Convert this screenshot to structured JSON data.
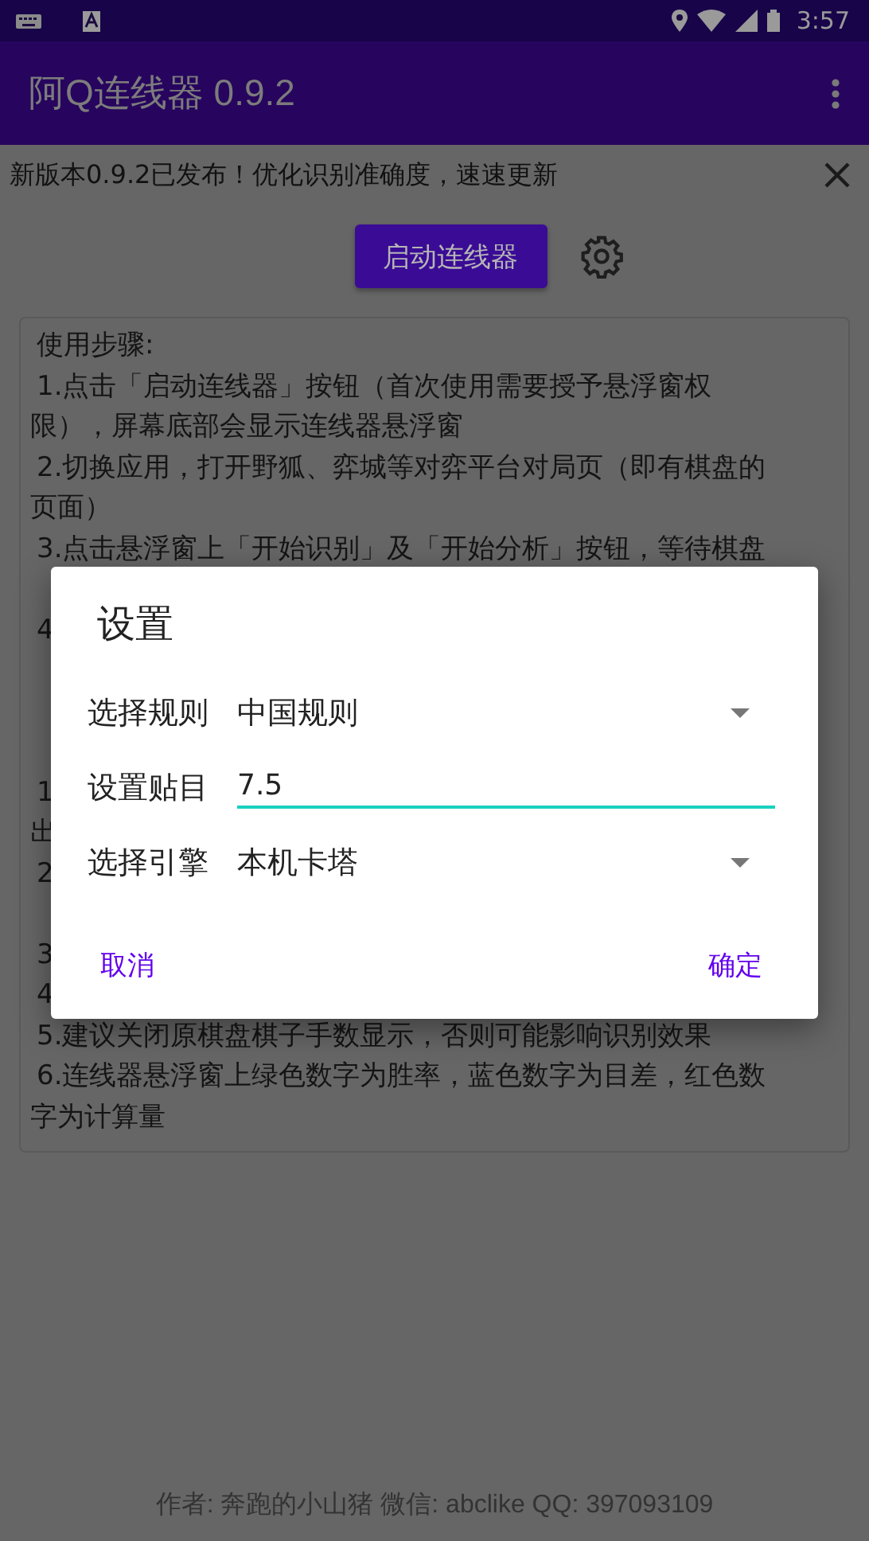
{
  "status_bar": {
    "time": "3:57"
  },
  "app_bar": {
    "title": "阿Q连线器 0.9.2"
  },
  "notice": {
    "text": "新版本0.9.2已发布！优化识别准确度，速速更新"
  },
  "start_button": {
    "label": "启动连线器"
  },
  "instructions": [
    {
      "kind": "lead",
      "text": "使用步骤:"
    },
    {
      "kind": "lead",
      "text": "1.点击「启动连线器」按钮（首次使用需要授予悬浮窗权"
    },
    {
      "kind": "cont",
      "text": "限），屏幕底部会显示连线器悬浮窗"
    },
    {
      "kind": "lead",
      "text": "2.切换应用，打开野狐、弈城等对弈平台对局页（即有棋盘的"
    },
    {
      "kind": "cont",
      "text": "页面）"
    },
    {
      "kind": "lead",
      "text": "3.点击悬浮窗上「开始识别」及「开始分析」按钮，等待棋盘"
    },
    {
      "kind": "gap"
    },
    {
      "kind": "lead",
      "text": "4"
    },
    {
      "kind": "gap"
    },
    {
      "kind": "gap"
    },
    {
      "kind": "gap"
    },
    {
      "kind": "lead",
      "text": "1"
    },
    {
      "kind": "cont",
      "text": "出"
    },
    {
      "kind": "lead",
      "text": "2"
    },
    {
      "kind": "gap"
    },
    {
      "kind": "lead",
      "text": "3"
    },
    {
      "kind": "lead",
      "text": "4"
    },
    {
      "kind": "lead",
      "text": "5.建议关闭原棋盘棋子手数显示，否则可能影响识别效果"
    },
    {
      "kind": "lead",
      "text": "6.连线器悬浮窗上绿色数字为胜率，蓝色数字为目差，红色数"
    },
    {
      "kind": "cont",
      "text": "字为计算量"
    }
  ],
  "footer": {
    "text": "作者: 奔跑的小山猪 微信: abclike QQ: 397093109"
  },
  "dialog": {
    "title": "设置",
    "fields": [
      {
        "kind": "select",
        "label": "选择规则",
        "value": "中国规则"
      },
      {
        "kind": "input",
        "label": "设置贴目",
        "value": "7.5"
      },
      {
        "kind": "select",
        "label": "选择引擎",
        "value": "本机卡塔"
      }
    ],
    "buttons": [
      {
        "label": "取消"
      },
      {
        "label": "确定"
      }
    ]
  }
}
